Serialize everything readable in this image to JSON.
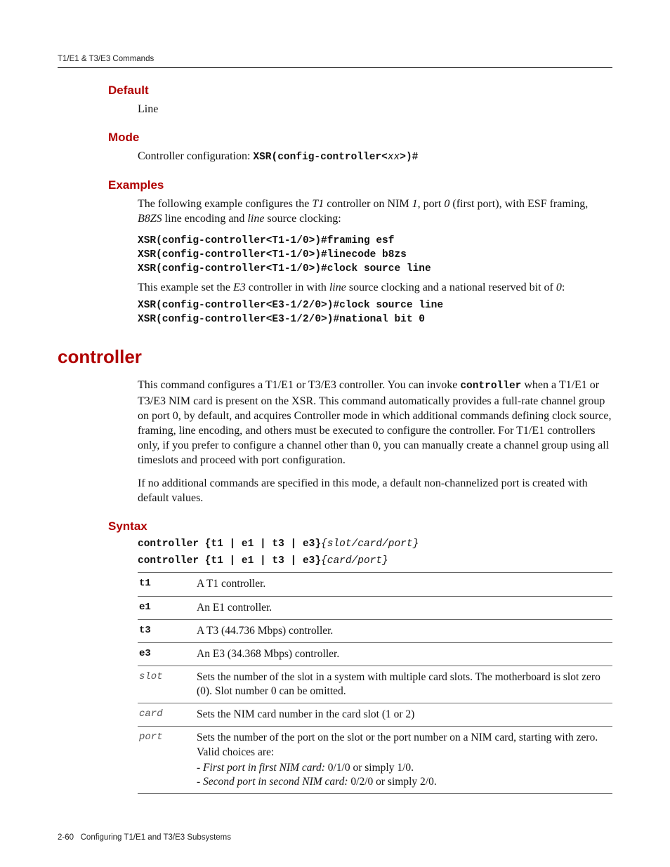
{
  "header": {
    "running": "T1/E1 & T3/E3 Commands"
  },
  "sections": {
    "default": {
      "heading": "Default",
      "text": "Line"
    },
    "mode": {
      "heading": "Mode",
      "intro": "Controller configuration: ",
      "code": "XSR(config-controller<",
      "arg": "xx",
      "code2": ">)#"
    },
    "examples": {
      "heading": "Examples",
      "p1a": "The following example configures the ",
      "p1i1": "T1",
      "p1b": " controller on NIM ",
      "p1i2": "1",
      "p1c": ", port ",
      "p1i3": "0",
      "p1d": " (first port), with ESF framing, ",
      "p1i4": "B8ZS",
      "p1e": " line encoding and ",
      "p1i5": "line",
      "p1f": " source clocking:",
      "code1": "XSR(config-controller<T1-1/0>)#framing esf\nXSR(config-controller<T1-1/0>)#linecode b8zs\nXSR(config-controller<T1-1/0>)#clock source line",
      "p2a": "This example set the ",
      "p2i1": "E3",
      "p2b": " controller in with ",
      "p2i2": "line",
      "p2c": " source clocking and a national reserved bit of ",
      "p2i3": "0",
      "p2d": ":",
      "code2": "XSR(config-controller<E3-1/2/0>)#clock source line\nXSR(config-controller<E3-1/2/0>)#national bit 0"
    },
    "controller": {
      "heading": "controller",
      "p1a": "This command configures a T1/E1 or T3/E3 controller. You can invoke ",
      "p1code": "controller",
      "p1b": " when a T1/E1 or T3/E3 NIM card is present on the XSR. This command automatically provides a full-rate channel group on port 0, by default, and acquires Controller mode in which additional commands defining clock source, framing, line encoding, and others must be executed to configure the controller. For T1/E1 controllers only, if you prefer to configure a channel other than 0, you can manually create a channel group using all timeslots and proceed with port configuration.",
      "p2": "If no additional commands are specified in this mode, a default non-channelized port is created with default values."
    },
    "syntax": {
      "heading": "Syntax",
      "line1_kw": "controller ",
      "line1_opts": "{t1 | e1 | t3 | e3}",
      "line1_arg": "{slot/card/port}",
      "line2_kw": "controller ",
      "line2_opts": "{t1 | e1 | t3 | e3}",
      "line2_arg": "{card/port}",
      "rows": [
        {
          "k": "t1",
          "arg": false,
          "d": "A T1 controller."
        },
        {
          "k": "e1",
          "arg": false,
          "d": "An E1 controller."
        },
        {
          "k": "t3",
          "arg": false,
          "d": "A T3 (44.736 Mbps) controller."
        },
        {
          "k": "e3",
          "arg": false,
          "d": "An E3 (34.368 Mbps) controller."
        },
        {
          "k": "slot",
          "arg": true,
          "d": "Sets the number of the slot in a system with multiple card slots. The motherboard is slot zero (0). Slot number 0 can be omitted."
        },
        {
          "k": "card",
          "arg": true,
          "d": "Sets the NIM card number in the card slot (1 or 2)"
        },
        {
          "k": "port",
          "arg": true,
          "d": "Sets the number of the port on the slot or the port number on a NIM card, starting with zero. Valid choices are:",
          "sub": [
            {
              "i": "First port in first NIM card:",
              "t": " 0/1/0 or simply 1/0."
            },
            {
              "i": "Second port in second NIM card:",
              "t": " 0/2/0 or simply 2/0."
            }
          ]
        }
      ]
    }
  },
  "footer": {
    "pagelabel": "2-60",
    "chapter": "Configuring T1/E1 and T3/E3 Subsystems"
  }
}
